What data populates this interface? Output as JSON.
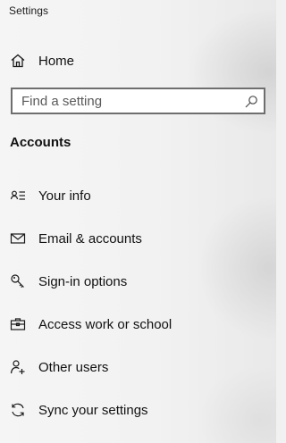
{
  "window": {
    "title": "Settings"
  },
  "home": {
    "label": "Home",
    "icon": "home-icon"
  },
  "search": {
    "placeholder": "Find a setting",
    "value": "",
    "icon": "search-icon"
  },
  "section": {
    "heading": "Accounts"
  },
  "nav": {
    "items": [
      {
        "label": "Your info",
        "icon": "contact-card-icon"
      },
      {
        "label": "Email & accounts",
        "icon": "mail-icon"
      },
      {
        "label": "Sign-in options",
        "icon": "key-icon"
      },
      {
        "label": "Access work or school",
        "icon": "briefcase-icon"
      },
      {
        "label": "Other users",
        "icon": "add-user-icon"
      },
      {
        "label": "Sync your settings",
        "icon": "sync-icon"
      }
    ]
  },
  "colors": {
    "background": "#f1f1f1",
    "text": "#111111",
    "search_border": "#6e6e6e"
  }
}
